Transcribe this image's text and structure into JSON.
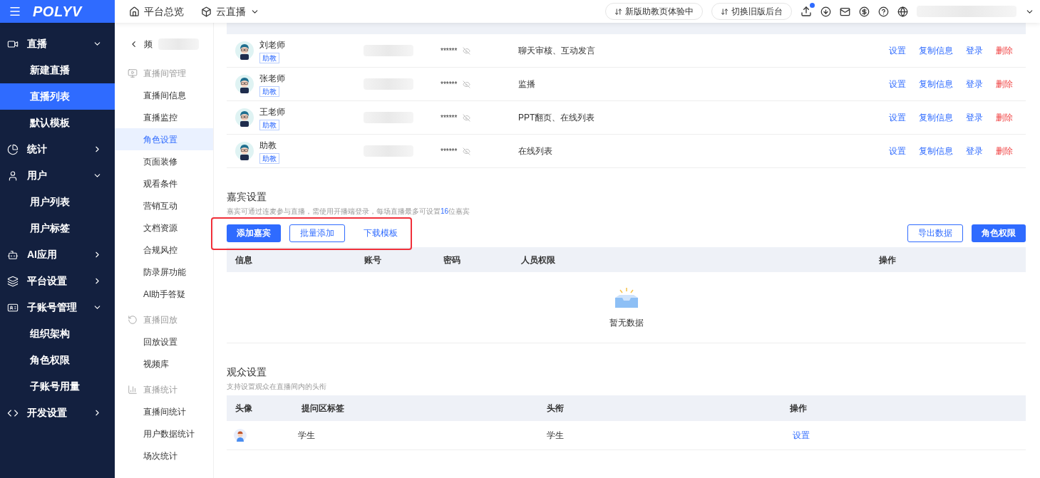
{
  "top_bar": {
    "logo": "POLYV",
    "nav": [
      {
        "label": "平台总览",
        "kind": "home"
      },
      {
        "label": "云直播",
        "kind": "cube"
      }
    ],
    "pill_buttons": [
      "新版助教页体验中",
      "切换旧版后台"
    ]
  },
  "main_nav": [
    {
      "label": "直播",
      "expanded": true,
      "children": [
        {
          "label": "新建直播",
          "selected": false
        },
        {
          "label": "直播列表",
          "selected": true
        },
        {
          "label": "默认模板",
          "selected": false
        }
      ]
    },
    {
      "label": "统计",
      "expanded": false
    },
    {
      "label": "用户",
      "expanded": true,
      "children": [
        {
          "label": "用户列表",
          "selected": false
        },
        {
          "label": "用户标签",
          "selected": false
        }
      ]
    },
    {
      "label": "AI应用",
      "expanded": false
    },
    {
      "label": "平台设置",
      "expanded": false
    },
    {
      "label": "子账号管理",
      "expanded": true,
      "children": [
        {
          "label": "组织架构",
          "selected": false
        },
        {
          "label": "角色权限",
          "selected": false
        },
        {
          "label": "子账号用量",
          "selected": false
        }
      ]
    },
    {
      "label": "开发设置",
      "expanded": false
    }
  ],
  "channel_nav": {
    "back_label": "频",
    "groups": [
      {
        "label": "直播间管理",
        "items": [
          {
            "label": "直播间信息",
            "selected": false
          },
          {
            "label": "直播监控",
            "selected": false
          },
          {
            "label": "角色设置",
            "selected": true
          },
          {
            "label": "页面装修",
            "selected": false
          },
          {
            "label": "观看条件",
            "selected": false
          },
          {
            "label": "营销互动",
            "selected": false
          },
          {
            "label": "文档资源",
            "selected": false
          },
          {
            "label": "合规风控",
            "selected": false
          },
          {
            "label": "防录屏功能",
            "selected": false
          },
          {
            "label": "AI助手答疑",
            "selected": false
          }
        ]
      },
      {
        "label": "直播回放",
        "items": [
          {
            "label": "回放设置",
            "selected": false
          },
          {
            "label": "视频库",
            "selected": false
          }
        ]
      },
      {
        "label": "直播统计",
        "items": [
          {
            "label": "直播间统计",
            "selected": false
          },
          {
            "label": "用户数据统计",
            "selected": false
          },
          {
            "label": "场次统计",
            "selected": false
          }
        ]
      }
    ]
  },
  "assistant_table": {
    "rows": [
      {
        "name": "刘老师",
        "tag": "助教",
        "password": "******",
        "permissions": "聊天审核、互动发言",
        "actions": [
          {
            "label": "设置",
            "kind": "link"
          },
          {
            "label": "复制信息",
            "kind": "link"
          },
          {
            "label": "登录",
            "kind": "link"
          },
          {
            "label": "删除",
            "kind": "danger"
          }
        ]
      },
      {
        "name": "张老师",
        "tag": "助教",
        "password": "******",
        "permissions": "监播",
        "actions": [
          {
            "label": "设置",
            "kind": "link"
          },
          {
            "label": "复制信息",
            "kind": "link"
          },
          {
            "label": "登录",
            "kind": "link"
          },
          {
            "label": "删除",
            "kind": "danger"
          }
        ]
      },
      {
        "name": "王老师",
        "tag": "助教",
        "password": "******",
        "permissions": "PPT翻页、在线列表",
        "actions": [
          {
            "label": "设置",
            "kind": "link"
          },
          {
            "label": "复制信息",
            "kind": "link"
          },
          {
            "label": "登录",
            "kind": "link"
          },
          {
            "label": "删除",
            "kind": "danger"
          }
        ]
      },
      {
        "name": "助教",
        "tag": "助教",
        "password": "******",
        "permissions": "在线列表",
        "actions": [
          {
            "label": "设置",
            "kind": "link"
          },
          {
            "label": "复制信息",
            "kind": "link"
          },
          {
            "label": "登录",
            "kind": "link"
          },
          {
            "label": "删除",
            "kind": "danger"
          }
        ]
      }
    ]
  },
  "guest_settings": {
    "title": "嘉宾设置",
    "description": "嘉宾可通过连麦参与直播，需使用开播端登录，每场直播最多可设置",
    "description_count": "16",
    "description_suffix": "位嘉宾",
    "left_buttons": [
      {
        "label": "添加嘉宾",
        "kind": "primary"
      },
      {
        "label": "批量添加",
        "kind": "outline"
      },
      {
        "label": "下载模板",
        "kind": "text"
      }
    ],
    "right_buttons": [
      {
        "label": "导出数据",
        "kind": "outline"
      },
      {
        "label": "角色权限",
        "kind": "primary"
      }
    ],
    "columns": [
      "信息",
      "账号",
      "密码",
      "人员权限",
      "操作"
    ],
    "empty_text": "暂无数据"
  },
  "audience_settings": {
    "title": "观众设置",
    "description": "支持设置观众在直播间内的头衔",
    "columns": [
      "头像",
      "提问区标签",
      "头衔",
      "操作"
    ],
    "rows": [
      {
        "label": "学生",
        "title": "学生",
        "action": "设置"
      }
    ]
  }
}
